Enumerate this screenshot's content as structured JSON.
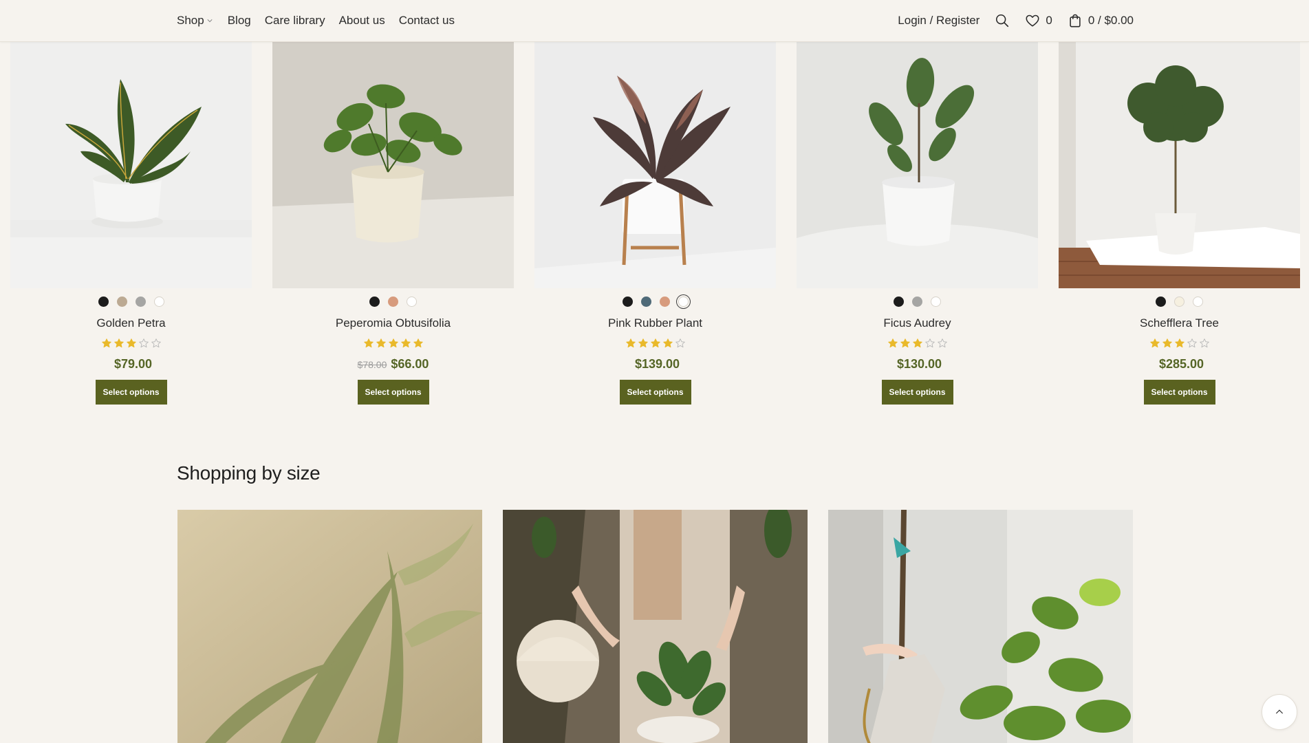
{
  "header": {
    "nav": [
      "Shop",
      "Blog",
      "Care library",
      "About us",
      "Contact us"
    ],
    "account_label": "Login / Register",
    "wishlist_count": "0",
    "cart_label": "0 / $0.00"
  },
  "products": [
    {
      "name": "Golden Petra",
      "swatches": [
        "#1c1c1c",
        "#bcaa93",
        "#a5a5a3",
        "#ffffff"
      ],
      "selected_swatch": null,
      "rating": 3,
      "rating_max": 5,
      "price": "$79.00",
      "old_price": null,
      "button": "Select options"
    },
    {
      "name": "Peperomia Obtusifolia",
      "swatches": [
        "#1c1c1c",
        "#d79b7d",
        "#ffffff"
      ],
      "selected_swatch": null,
      "rating": 5,
      "rating_max": 5,
      "price": "$66.00",
      "old_price": "$78.00",
      "button": "Select options"
    },
    {
      "name": "Pink Rubber Plant",
      "swatches": [
        "#1c1c1c",
        "#4f6a78",
        "#d79b7d",
        "#ffffff"
      ],
      "selected_swatch": 3,
      "rating": 4,
      "rating_max": 5,
      "price": "$139.00",
      "old_price": null,
      "button": "Select options"
    },
    {
      "name": "Ficus Audrey",
      "swatches": [
        "#1c1c1c",
        "#a5a5a3",
        "#ffffff"
      ],
      "selected_swatch": null,
      "rating": 3,
      "rating_max": 5,
      "price": "$130.00",
      "old_price": null,
      "button": "Select options"
    },
    {
      "name": "Schefflera Tree",
      "swatches": [
        "#1c1c1c",
        "#f6f0e0",
        "#ffffff"
      ],
      "selected_swatch": null,
      "rating": 3,
      "rating_max": 5,
      "price": "$285.00",
      "old_price": null,
      "button": "Select options"
    }
  ],
  "size_section": {
    "title": "Shopping by size"
  },
  "colors": {
    "button_bg": "#5a6220",
    "price": "#556526",
    "star": "#e9b92b",
    "page_bg": "#f6f3ee"
  },
  "icons": {
    "search": "search-icon",
    "wishlist": "heart-icon",
    "cart": "shopping-bag-icon",
    "back_to_top": "chevron-up-icon"
  }
}
